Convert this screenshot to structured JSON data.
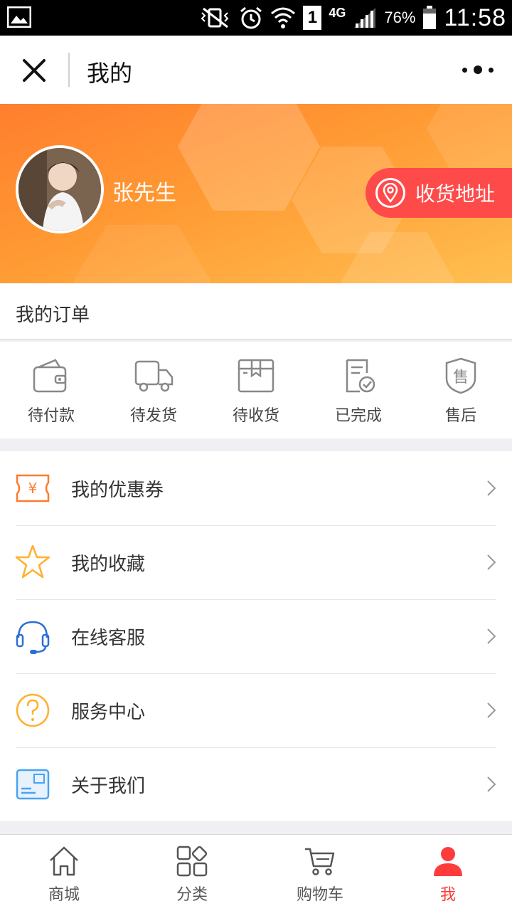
{
  "status_bar": {
    "network": "4G",
    "sim_slot": "1",
    "battery": "76%",
    "time": "11:58"
  },
  "nav": {
    "title": "我的",
    "close_icon": "close-icon",
    "more_icon": "more-dots-icon"
  },
  "profile": {
    "username": "张先生",
    "address_button": "收货地址"
  },
  "orders": {
    "title": "我的订单",
    "items": [
      {
        "label": "待付款",
        "icon": "wallet-icon"
      },
      {
        "label": "待发货",
        "icon": "truck-icon"
      },
      {
        "label": "待收货",
        "icon": "package-icon"
      },
      {
        "label": "已完成",
        "icon": "completed-doc-icon"
      },
      {
        "label": "售后",
        "icon": "after-sale-shield-icon"
      }
    ]
  },
  "menu": {
    "items": [
      {
        "label": "我的优惠券",
        "icon": "coupon-icon",
        "color": "#ff7a2e"
      },
      {
        "label": "我的收藏",
        "icon": "star-icon",
        "color": "#ffb030"
      },
      {
        "label": "在线客服",
        "icon": "headset-icon",
        "color": "#2b6fd6"
      },
      {
        "label": "服务中心",
        "icon": "question-icon",
        "color": "#ffb030"
      },
      {
        "label": "关于我们",
        "icon": "about-card-icon",
        "color": "#4aa3f0"
      }
    ]
  },
  "tabs": [
    {
      "label": "商城",
      "icon": "home-icon",
      "active": false
    },
    {
      "label": "分类",
      "icon": "category-icon",
      "active": false
    },
    {
      "label": "购物车",
      "icon": "cart-icon",
      "active": false
    },
    {
      "label": "我",
      "icon": "user-icon",
      "active": true
    }
  ],
  "colors": {
    "accent": "#ff3b3b",
    "banner_start": "#ff7e2e",
    "banner_end": "#ffbf50"
  }
}
